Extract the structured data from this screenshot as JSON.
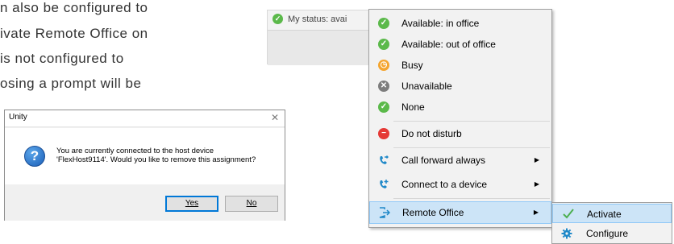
{
  "document": {
    "lines": [
      "n also be configured to",
      "ivate Remote Office on",
      "is not configured to",
      "osing a prompt will be"
    ]
  },
  "dialog": {
    "title": "Unity",
    "close_glyph": "✕",
    "message_line1": "You are currently connected to the host device",
    "message_line2": "'FlexHost9114'.  Would you like to remove this assignment?",
    "yes_label": "Yes",
    "no_label": "No",
    "icon": "question-icon"
  },
  "statusbar": {
    "text": "My status: avai",
    "icon": "check-icon"
  },
  "menu": {
    "items": [
      {
        "label": "Available: in office",
        "icon": "check-icon",
        "color": "#5bb94a"
      },
      {
        "label": "Available: out of office",
        "icon": "check-icon",
        "color": "#5bb94a"
      },
      {
        "label": "Busy",
        "icon": "clock-icon",
        "color": "#f4a52f"
      },
      {
        "label": "Unavailable",
        "icon": "x-icon",
        "color": "#7d7d7d"
      },
      {
        "label": "None",
        "icon": "check-icon",
        "color": "#5bb94a"
      },
      {
        "label": "Do not disturb",
        "icon": "minus-icon",
        "color": "#e53935"
      },
      {
        "label": "Call forward always",
        "icon": "phone-forward-icon",
        "color": "#1e88c8"
      },
      {
        "label": "Connect to a device",
        "icon": "phone-plus-icon",
        "color": "#1e88c8"
      },
      {
        "label": "Remote Office",
        "icon": "remote-office-icon",
        "color": "#1e88c8"
      }
    ]
  },
  "submenu": {
    "items": [
      {
        "label": "Activate",
        "icon": "checkmark-icon",
        "color": "#4caf50"
      },
      {
        "label": "Configure",
        "icon": "gear-icon",
        "color": "#1e88c8"
      }
    ]
  }
}
